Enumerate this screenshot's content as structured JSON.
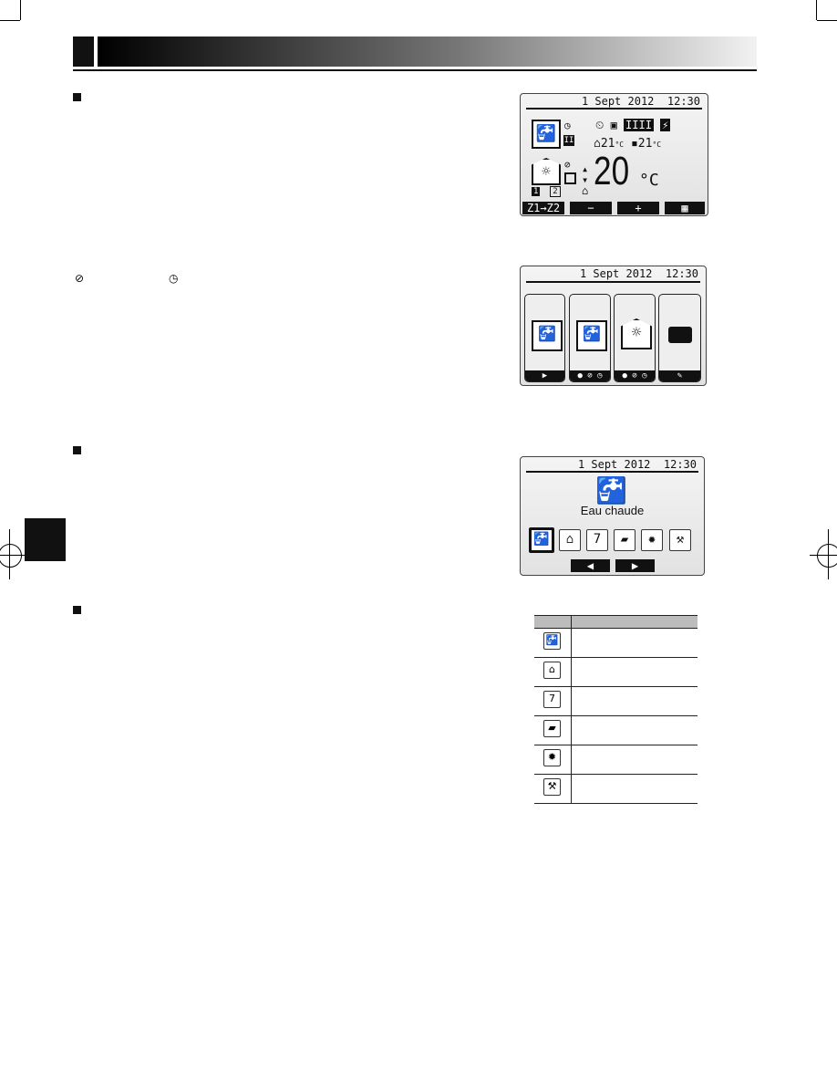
{
  "colors": {
    "header_start": "#000000",
    "header_end": "#f2f2f2",
    "table_header": "#bcbcbc",
    "lcd_bg": "#e8e8e8"
  },
  "screen_main": {
    "date": "1 Sept 2012",
    "time": "12:30",
    "room_temp": "21",
    "tank_temp": "21",
    "unit_small": "°C",
    "target_temp": "20",
    "unit": "°C",
    "zone1": "1",
    "zone2": "2",
    "buttons": [
      "Z1→Z2",
      "−",
      "+",
      "menu-icon"
    ]
  },
  "screen_modes": {
    "date": "1 Sept 2012",
    "time": "12:30",
    "tiles": [
      {
        "icon": "tap-thermometer-icon",
        "footer": "play-icon"
      },
      {
        "icon": "tap-prohibited-icon",
        "footer": "play-prohibited-clock-icons"
      },
      {
        "icon": "house-sun-clock-icon",
        "footer": "play-prohibited-clock-icons"
      },
      {
        "icon": "suitcase-icon",
        "footer": "edit-icon"
      }
    ]
  },
  "screen_menu": {
    "date": "1 Sept 2012",
    "time": "12:30",
    "selected_label": "Eau chaude",
    "icons": [
      "tap-icon",
      "house-icon",
      "calendar-clock-icon",
      "suitcase-icon",
      "gear-icon",
      "tools-icon"
    ]
  },
  "legend_symbols": {
    "prohibit": "⊘",
    "timer": "◷"
  },
  "table": {
    "rows": [
      "tap-icon",
      "house-icon",
      "calendar-clock-icon",
      "suitcase-icon",
      "gear-icon",
      "tools-icon"
    ]
  }
}
